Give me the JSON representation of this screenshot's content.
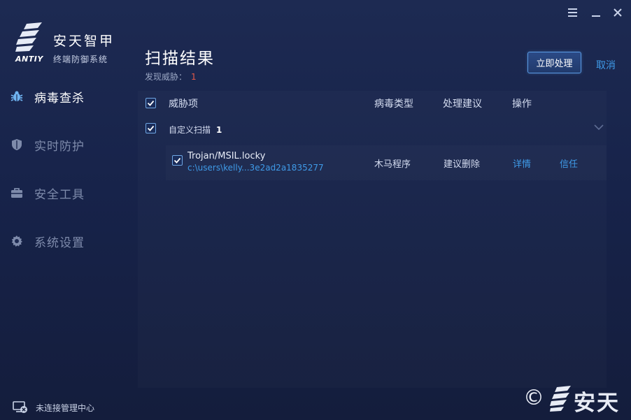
{
  "window": {
    "controls": {
      "menu_icon": "menu-icon",
      "minimize_icon": "minimize-icon",
      "close_icon": "close-icon"
    }
  },
  "brand": {
    "wordmark": "ANTIY",
    "title": "安天智甲",
    "subtitle": "终端防御系统"
  },
  "sidebar": {
    "items": [
      {
        "label": "病毒查杀",
        "icon": "bug-icon",
        "active": true
      },
      {
        "label": "实时防护",
        "icon": "shield-icon",
        "active": false
      },
      {
        "label": "安全工具",
        "icon": "toolbox-icon",
        "active": false
      },
      {
        "label": "系统设置",
        "icon": "gear-icon",
        "active": false
      }
    ],
    "connection_status": "未连接管理中心"
  },
  "main": {
    "title": "扫描结果",
    "threat_label": "发现威胁：",
    "threat_count": "1",
    "process_button": "立即处理",
    "cancel_link": "取消",
    "columns": {
      "threat": "威胁项",
      "type": "病毒类型",
      "advice": "处理建议",
      "operation": "操作"
    },
    "group": {
      "label": "自定义扫描",
      "count": "1"
    },
    "items": [
      {
        "name": "Trojan/MSIL.locky",
        "path": "c:\\users\\kelly...3e2ad2a1835277",
        "type": "木马程序",
        "advice": "建议删除",
        "detail": "详情",
        "trust": "信任"
      }
    ]
  },
  "watermark": {
    "text": "安天"
  },
  "colors": {
    "accent": "#3f9be8",
    "threat_count": "#e35a4a",
    "background": "#17234a"
  }
}
